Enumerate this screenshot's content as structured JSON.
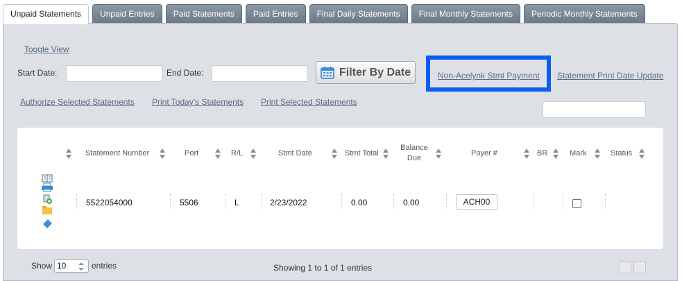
{
  "tabs": [
    "Unpaid Statements",
    "Unpaid Entries",
    "Paid Statements",
    "Paid Entries",
    "Final Daily Statements",
    "Final Monthly Statements",
    "Periodic Monthly Statements"
  ],
  "toolbar": {
    "toggle_view": "Toggle View",
    "start_date_label": "Start Date:",
    "end_date_label": "End Date:",
    "filter_button": "Filter By Date",
    "non_acelynk_link": "Non-Acelynk Stmt Payment",
    "print_date_update_link": "Statement Print Date Update",
    "authorize_link": "Authorize Selected Statements",
    "print_today_link": "Print Today's Statements",
    "print_selected_link": "Print Selected Statements"
  },
  "table": {
    "headers": {
      "statement_number": "Statement Number",
      "port": "Port",
      "rl": "R/L",
      "stmt_date": "Stmt Date",
      "stmt_total": "Stmt Total",
      "balance_due": "Balance Due",
      "payer": "Payer #",
      "br": "BR",
      "mark": "Mark",
      "status": "Status"
    },
    "rows": [
      {
        "statement_number": "5522054000",
        "port": "5506",
        "rl": "L",
        "stmt_date": "2/23/2022",
        "stmt_total": "0.00",
        "balance_due": "0.00",
        "payer": "ACH00",
        "br": "",
        "mark": false,
        "status": ""
      }
    ]
  },
  "footer": {
    "show_label": "Show",
    "page_size": "10",
    "entries_label": "entries",
    "info": "Showing 1 to 1 of 1 entries"
  },
  "colors": {
    "tab_bg": "#7a8594",
    "panel_bg": "#dde1e6",
    "highlight": "#0b5cf0",
    "link": "#5a6b85"
  }
}
